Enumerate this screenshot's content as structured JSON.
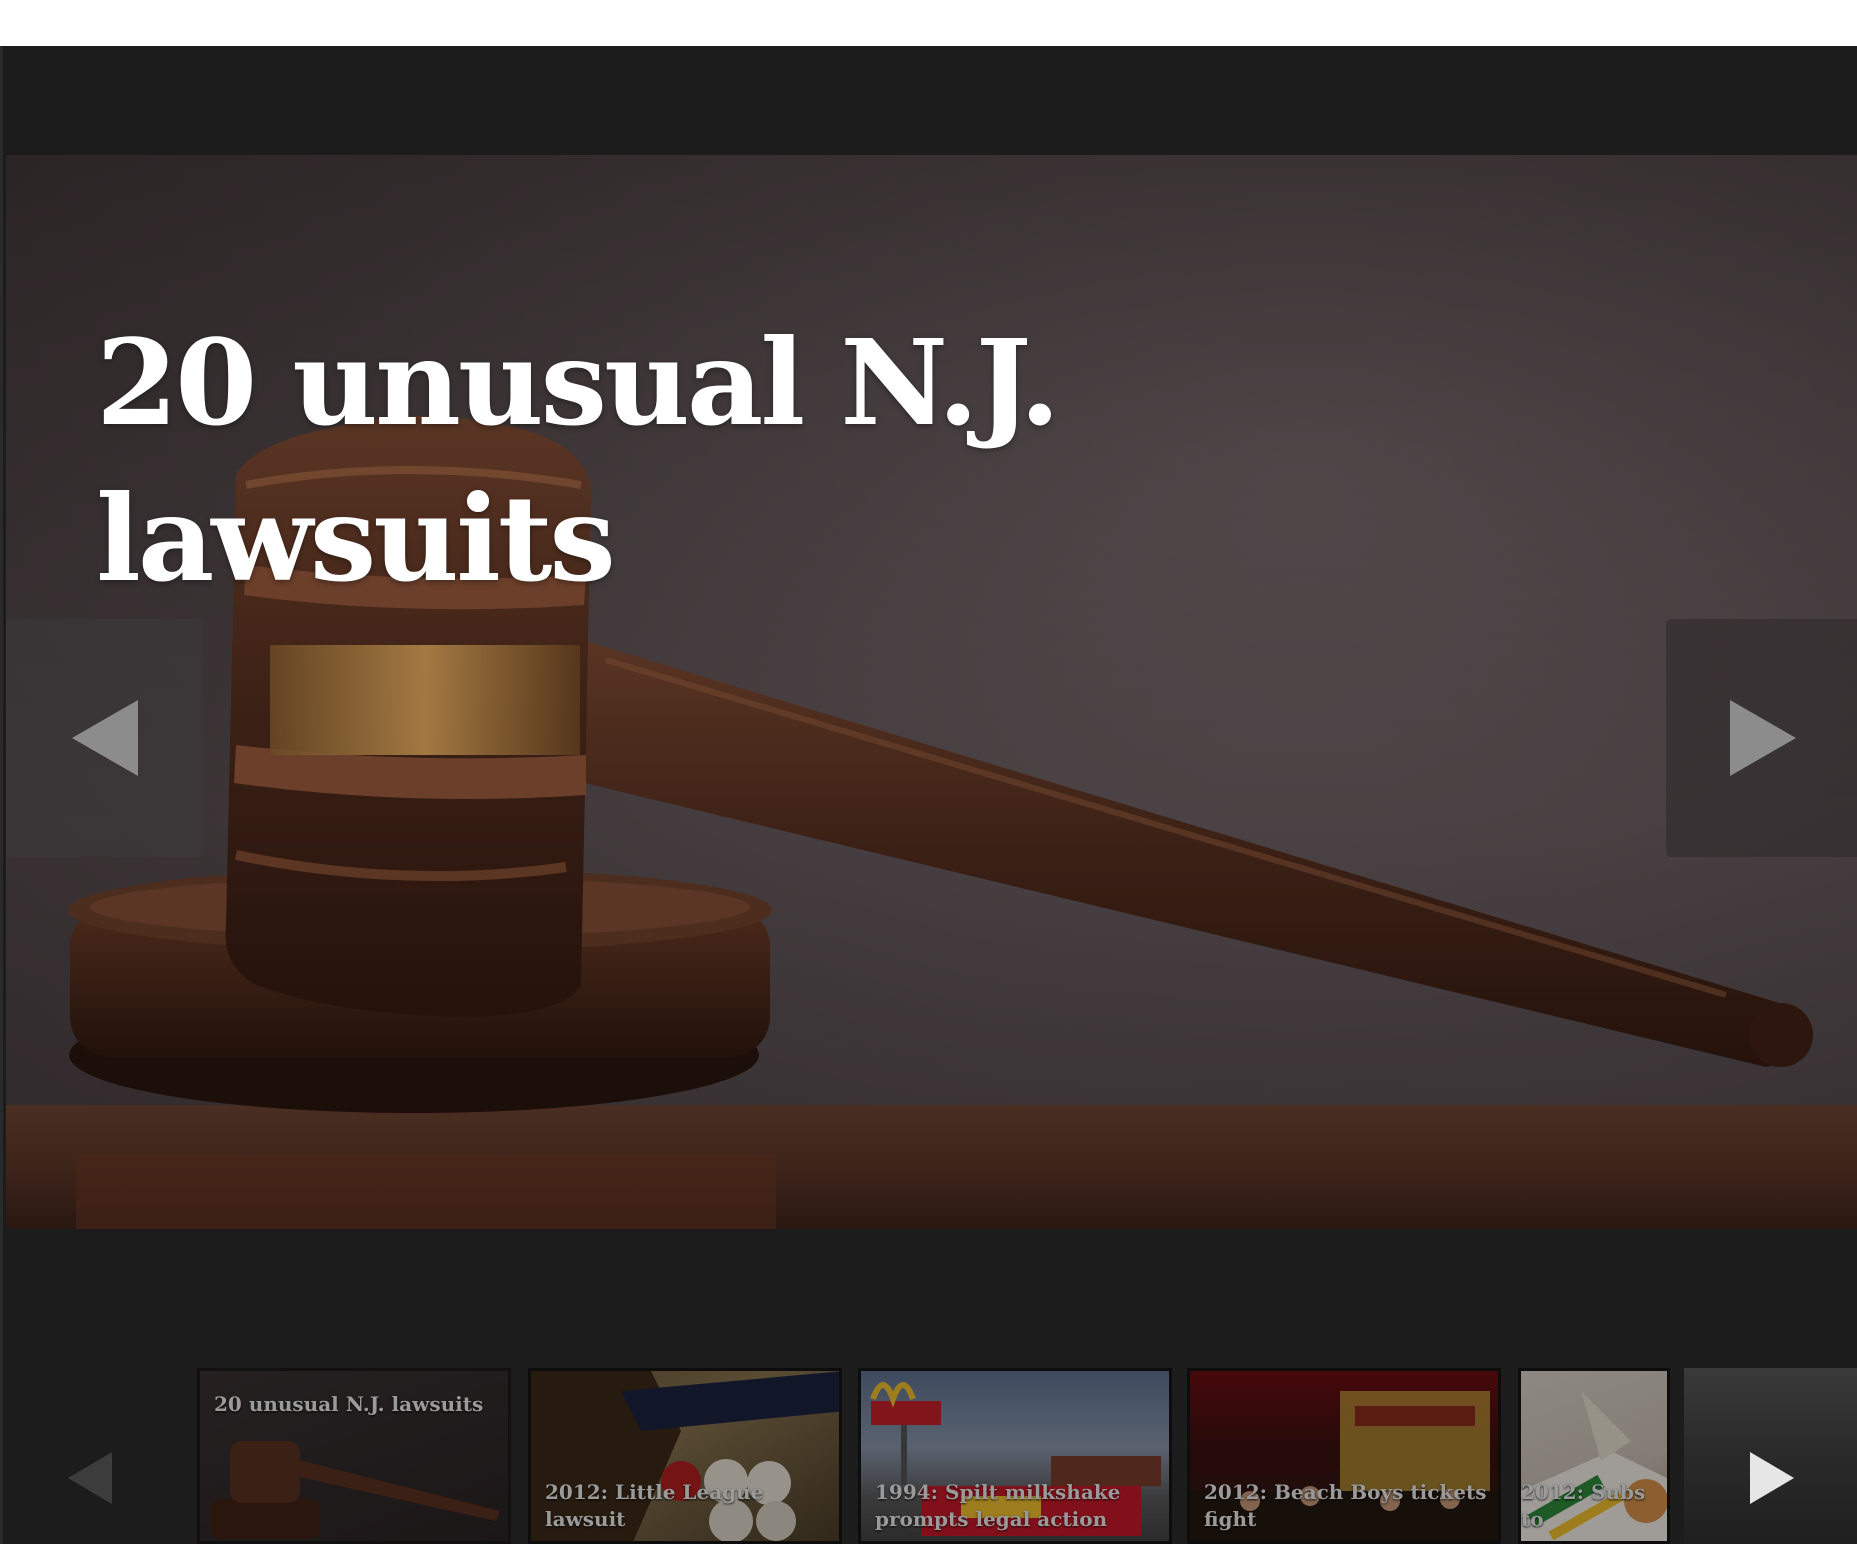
{
  "slideshow": {
    "current_slide": {
      "title": "20 unusual N.J. lawsuits",
      "image": "judge-gavel-photo"
    },
    "prev_icon": "triangle-left-icon",
    "next_icon": "triangle-right-icon",
    "colors": {
      "background": "#1c1c1c",
      "arrow": "#8c8c8c",
      "title": "#ffffff"
    }
  },
  "thumbnails": [
    {
      "label": "20 unusual N.J. lawsuits",
      "image": "gavel-thumbnail"
    },
    {
      "label": "2012: Little League lawsuit",
      "image": "baseball-glove-thumbnail"
    },
    {
      "label": "1994: Spilt milkshake prompts legal action",
      "image": "mcdonalds-sign-thumbnail"
    },
    {
      "label": "2012: Beach Boys tickets fight",
      "image": "concert-stage-thumbnail"
    },
    {
      "label": "2012: Subs to",
      "image": "subway-sandwich-thumbnail"
    }
  ]
}
